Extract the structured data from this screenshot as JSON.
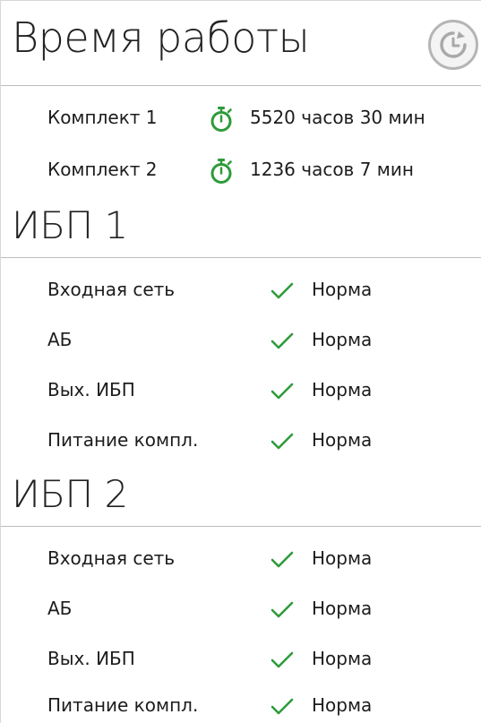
{
  "runtime": {
    "title": "Время работы",
    "refresh_icon": "refresh-clock-icon",
    "kits": [
      {
        "label": "Комплект 1",
        "value": "5520 часов 30 мин",
        "icon": "stopwatch-icon"
      },
      {
        "label": "Комплект 2",
        "value": "1236 часов 7 мин",
        "icon": "stopwatch-icon"
      }
    ]
  },
  "ups": [
    {
      "title": "ИБП 1",
      "rows": [
        {
          "label": "Входная сеть",
          "status": "Норма",
          "icon": "check-icon"
        },
        {
          "label": "АБ",
          "status": "Норма",
          "icon": "check-icon"
        },
        {
          "label": "Вых. ИБП",
          "status": "Норма",
          "icon": "check-icon"
        },
        {
          "label": "Питание компл.",
          "status": "Норма",
          "icon": "check-icon"
        }
      ]
    },
    {
      "title": "ИБП 2",
      "rows": [
        {
          "label": "Входная сеть",
          "status": "Норма",
          "icon": "check-icon"
        },
        {
          "label": "АБ",
          "status": "Норма",
          "icon": "check-icon"
        },
        {
          "label": "Вых. ИБП",
          "status": "Норма",
          "icon": "check-icon"
        },
        {
          "label": "Питание компл.",
          "status": "Норма",
          "icon": "check-icon"
        }
      ]
    }
  ],
  "colors": {
    "accent_green": "#2e9b3a",
    "divider": "#bdbdbd",
    "text": "#1c1c1c"
  }
}
